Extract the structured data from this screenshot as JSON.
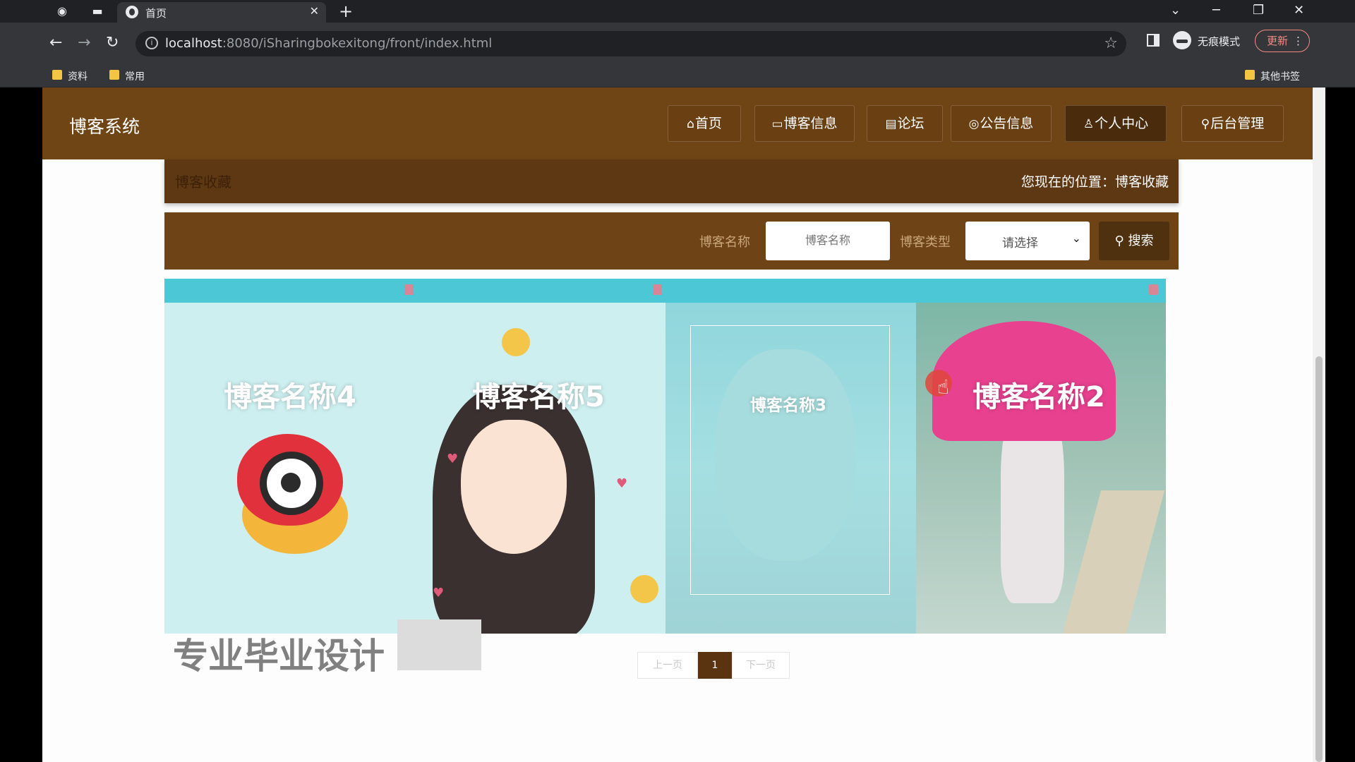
{
  "browser": {
    "tab_title": "首页",
    "url_host": "localhost",
    "url_rest": ":8080/iSharingbokexitong/front/index.html",
    "incognito_label": "无痕模式",
    "update_label": "更新",
    "bookmarks": [
      "资料",
      "常用"
    ],
    "other_bookmarks": "其他书签"
  },
  "header": {
    "site_title": "博客系统",
    "nav": [
      {
        "label": "首页",
        "icon": "home-icon"
      },
      {
        "label": "博客信息",
        "icon": "book-icon"
      },
      {
        "label": "论坛",
        "icon": "forum-icon"
      },
      {
        "label": "公告信息",
        "icon": "notice-icon"
      },
      {
        "label": "个人中心",
        "icon": "user-icon"
      },
      {
        "label": "后台管理",
        "icon": "link-icon"
      }
    ]
  },
  "breadcrumb": {
    "section": "博客收藏",
    "location_prefix": "您现在的位置：",
    "location": "博客收藏"
  },
  "search": {
    "name_label": "博客名称",
    "name_placeholder": "博客名称",
    "type_label": "博客类型",
    "type_selected": "请选择",
    "button_label": "搜索"
  },
  "cards": [
    {
      "name": "博客名称4"
    },
    {
      "name": "博客名称5"
    },
    {
      "name": "博客名称3"
    },
    {
      "name": "博客名称2"
    }
  ],
  "pagination": {
    "prev": "上一页",
    "current": "1",
    "next": "下一页"
  },
  "watermark": "专业毕业设计"
}
